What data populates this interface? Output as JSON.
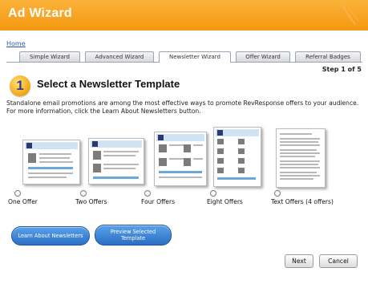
{
  "window": {
    "title": "Ad Wizard"
  },
  "breadcrumb": "Home",
  "tabs": [
    {
      "label": "Simple Wizard",
      "active": false
    },
    {
      "label": "Advanced Wizard",
      "active": false
    },
    {
      "label": "Newsletter Wizard",
      "active": true
    },
    {
      "label": "Offer Wizard",
      "active": false
    },
    {
      "label": "Referral Badges",
      "active": false
    }
  ],
  "step_indicator": "Step 1 of 5",
  "section": {
    "number": "1",
    "heading": "Select a Newsletter Template"
  },
  "description": "Standalone email promotions are among the most effective ways to promote RevResponse offers to your audience. For more information, click the Learn About Newsletters button.",
  "templates": [
    {
      "label": "One Offer"
    },
    {
      "label": "Two Offers"
    },
    {
      "label": "Four Offers"
    },
    {
      "label": "Eight Offers"
    },
    {
      "label": "Text Offers (4 offers)"
    }
  ],
  "actions": {
    "learn_label": "Learn About Newsletters",
    "preview_label": "Preview Selected Template",
    "next_label": "Next",
    "cancel_label": "Cancel"
  },
  "colors": {
    "title_bar": "#f5a11f",
    "accent_blue": "#2b6fc4",
    "link": "#2d58b0"
  }
}
